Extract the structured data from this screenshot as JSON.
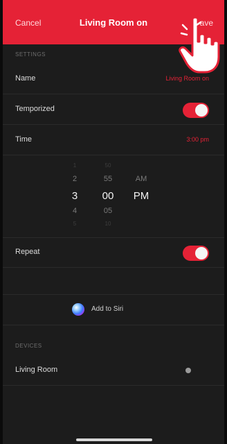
{
  "nav": {
    "cancel_label": "Cancel",
    "title": "Living Room on",
    "save_label": "Save"
  },
  "settings": {
    "section_header": "SETTINGS",
    "name_label": "Name",
    "name_value": "Living Room on",
    "temporized_label": "Temporized",
    "temporized_on": true,
    "time_label": "Time",
    "time_value": "3:00 pm",
    "repeat_label": "Repeat",
    "repeat_on": true
  },
  "time_picker": {
    "hours": [
      "1",
      "2",
      "3",
      "4",
      "5"
    ],
    "minutes": [
      "50",
      "55",
      "00",
      "05",
      "10"
    ],
    "periods": [
      "AM",
      "PM"
    ],
    "selected_hour": "3",
    "selected_minute": "00",
    "selected_period": "PM"
  },
  "siri": {
    "label": "Add to Siri"
  },
  "devices": {
    "section_header": "DEVICES",
    "items": [
      {
        "label": "Living Room"
      }
    ]
  },
  "colors": {
    "accent": "#e52236",
    "background": "#1c1c1c",
    "separator": "#2b2b2b"
  }
}
